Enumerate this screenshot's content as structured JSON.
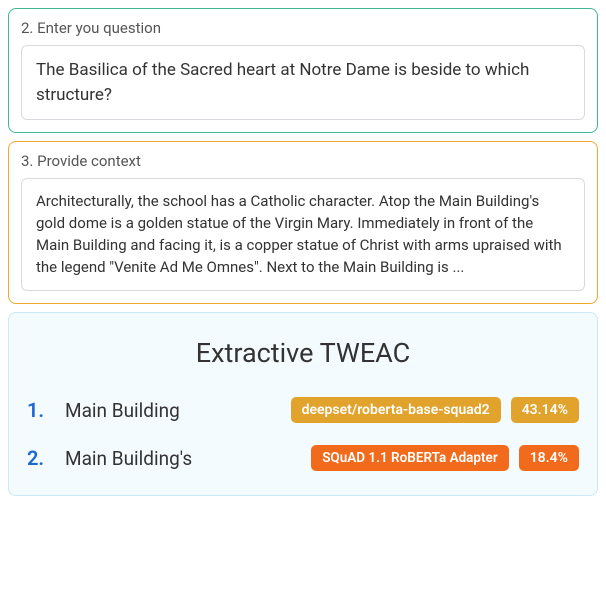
{
  "question_panel": {
    "label": "2. Enter you question",
    "value": "The Basilica of the Sacred heart at Notre Dame is beside to which structure?"
  },
  "context_panel": {
    "label": "3. Provide context",
    "value": "Architecturally, the school has a Catholic character. Atop the Main Building's gold dome is a golden statue of the Virgin Mary. Immediately in front of the Main Building and facing it, is a copper statue of Christ with arms upraised with the legend \"Venite Ad Me Omnes\". Next to the Main Building is ..."
  },
  "results": {
    "title": "Extractive TWEAC",
    "items": [
      {
        "rank": "1.",
        "answer": "Main Building",
        "model": "deepset/roberta-base-squad2",
        "score": "43.14%",
        "model_class": "pill-gold",
        "score_class": "pill-gold-sm"
      },
      {
        "rank": "2.",
        "answer": "Main Building's",
        "model": "SQuAD 1.1 RoBERTa Adapter",
        "score": "18.4%",
        "model_class": "pill-orange",
        "score_class": "pill-orange-sm"
      }
    ]
  }
}
